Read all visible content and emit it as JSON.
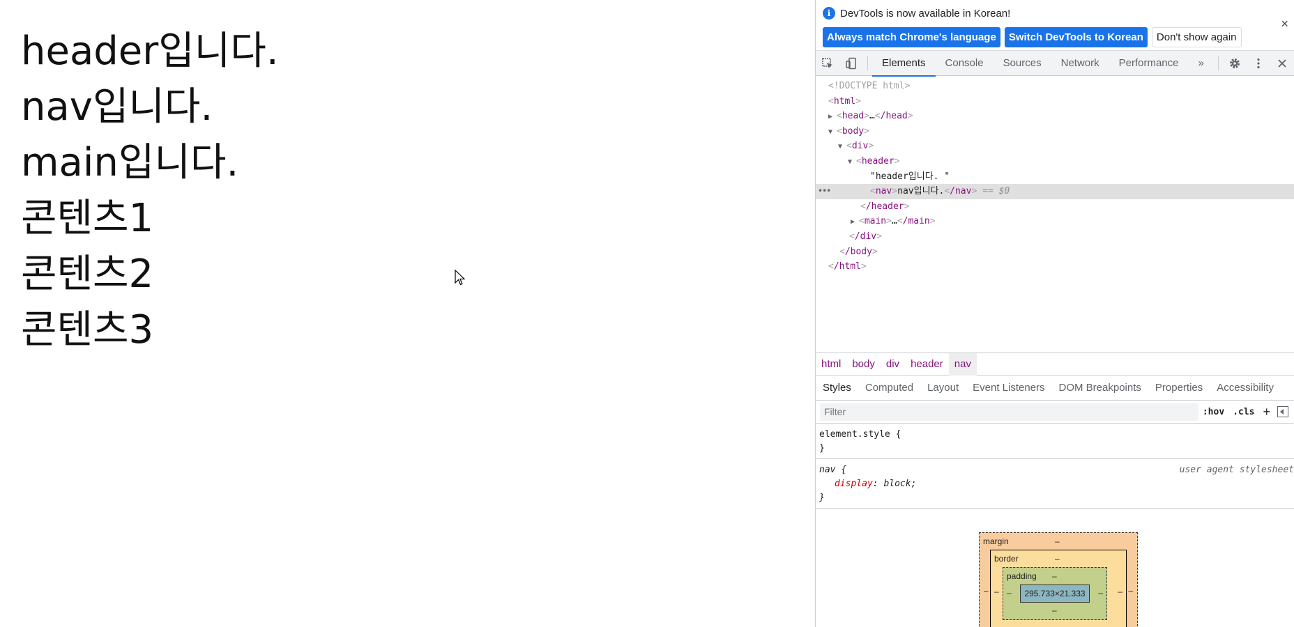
{
  "page": {
    "lines": [
      "header입니다.",
      "nav입니다.",
      "main입니다.",
      "콘텐츠1",
      "콘텐츠2",
      "콘텐츠3"
    ]
  },
  "devtools": {
    "infobar": {
      "message": "DevTools is now available in Korean!",
      "btn_match": "Always match Chrome's language",
      "btn_switch": "Switch DevTools to Korean",
      "btn_dont": "Don't show again",
      "close": "×"
    },
    "tabs": [
      "Elements",
      "Console",
      "Sources",
      "Network",
      "Performance"
    ],
    "more_tabs": "»",
    "dom": {
      "doctype": "<!DOCTYPE html>",
      "html_open": "html",
      "head_open": "head",
      "head_ellipsis": "…",
      "head_close": "/head",
      "body_open": "body",
      "div_open": "div",
      "header_open": "header",
      "header_text": "\"header입니다. \"",
      "nav_open": "nav",
      "nav_text": "nav입니다.",
      "nav_close": "/nav",
      "nav_eq": "== $0",
      "header_close": "/header",
      "main_open": "main",
      "main_ellipsis": "…",
      "main_close": "/main",
      "div_close": "/div",
      "body_close": "/body",
      "html_close": "/html",
      "row_menu": "•••"
    },
    "breadcrumbs": [
      "html",
      "body",
      "div",
      "header",
      "nav"
    ],
    "subtabs": [
      "Styles",
      "Computed",
      "Layout",
      "Event Listeners",
      "DOM Breakpoints",
      "Properties",
      "Accessibility"
    ],
    "filter": {
      "placeholder": "Filter",
      "hov": ":hov",
      "cls": ".cls",
      "plus": "+"
    },
    "rules": {
      "element_style": "element.style {",
      "close_brace": "}",
      "nav_selector": "nav {",
      "nav_prop": "display",
      "nav_val": "block;",
      "nav_source": "user agent stylesheet"
    },
    "boxmodel": {
      "margin": "margin",
      "border": "border",
      "padding": "padding",
      "dash": "–",
      "content": "295.733×21.333"
    }
  }
}
